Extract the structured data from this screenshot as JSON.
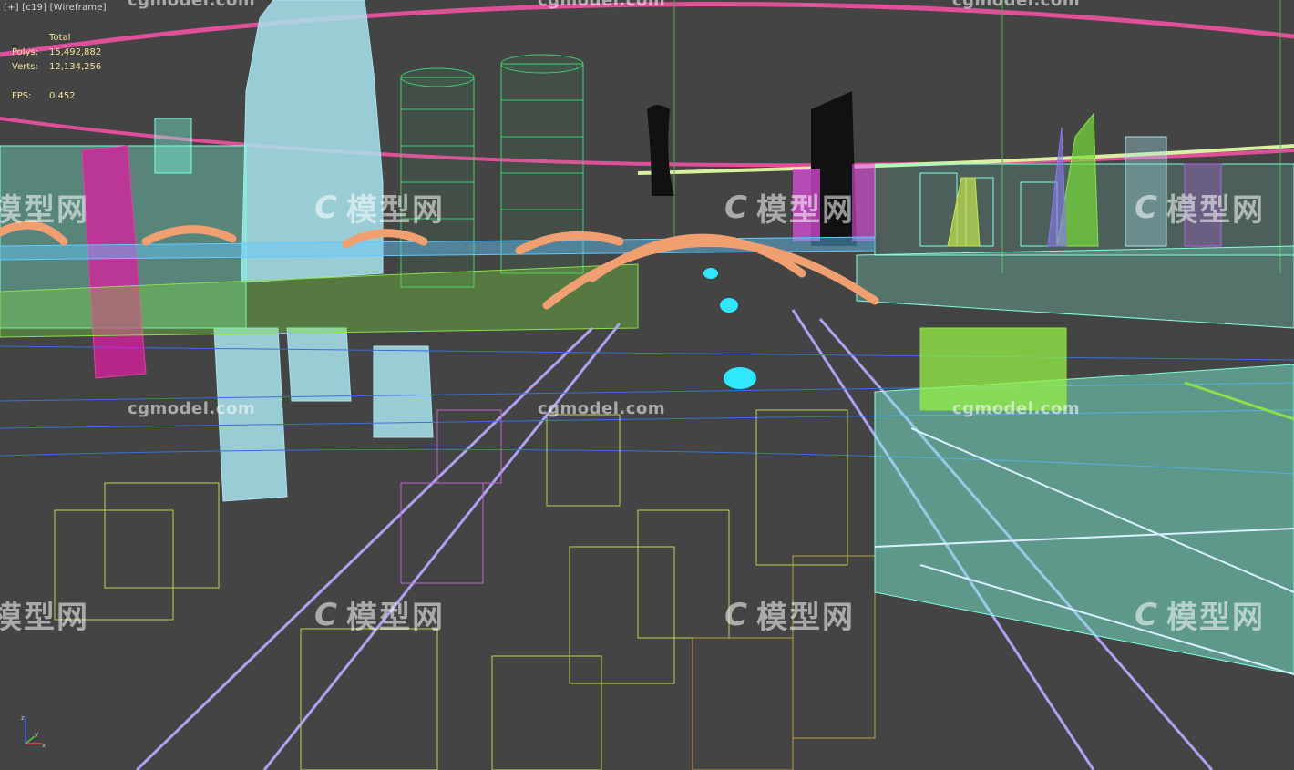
{
  "viewport": {
    "label": "[+] [c19] [Wireframe]"
  },
  "stats": {
    "header": "Total",
    "polys_label": "Polys:",
    "polys_value": "15,492,882",
    "verts_label": "Verts:",
    "verts_value": "12,134,256",
    "fps_label": "FPS:",
    "fps_value": "0.452"
  },
  "watermark": {
    "url": "cgmodel.com",
    "logo_mark": "C",
    "logo_text": "模型网"
  },
  "axis_gizmo": {
    "x": "x",
    "y": "y",
    "z": "z"
  },
  "colors": {
    "background": "#444444",
    "cyan": "#7fffe0",
    "lightblue": "#a9e4f0",
    "green": "#8be04a",
    "pink": "#e040a0",
    "orange": "#f0a070",
    "yellowgreen": "#b6d84c",
    "lavender": "#b0a0f0"
  }
}
